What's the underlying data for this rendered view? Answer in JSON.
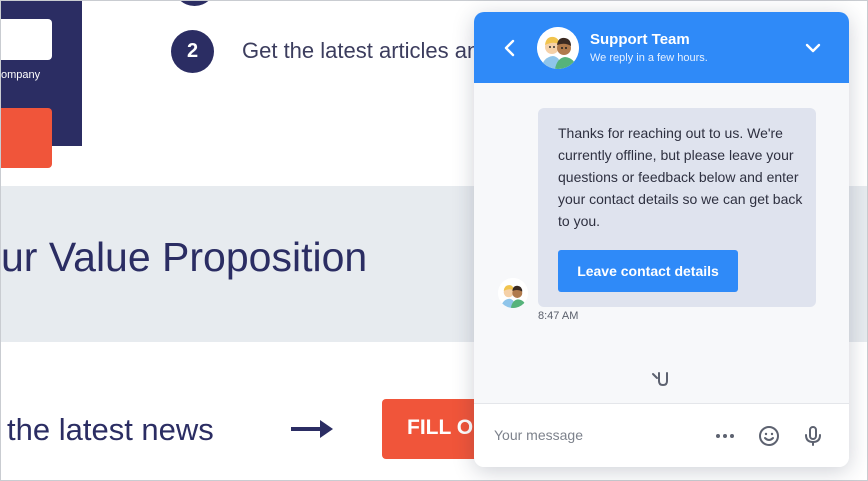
{
  "website": {
    "company_partial": "ompany",
    "step_number": "2",
    "step_text": "Get the latest articles and",
    "value_title": "ur Value Proposition",
    "news_text": "the latest news",
    "fill_button": "FILL OU"
  },
  "chat": {
    "header": {
      "title": "Support Team",
      "status": "We reply in a few hours.",
      "back_icon": "chevron-left-icon",
      "collapse_icon": "chevron-down-icon"
    },
    "message": {
      "text": "Thanks for reaching out to us. We're currently offline, but please leave your questions or feedback below and enter your contact details so we can get back to you.",
      "button_label": "Leave contact details",
      "time": "8:47 AM"
    },
    "composer": {
      "placeholder": "Your message",
      "icons": [
        "more-icon",
        "emoji-icon",
        "mic-icon"
      ]
    }
  },
  "colors": {
    "accent": "#2f8af8",
    "navy": "#2b2d63",
    "orange": "#f0553a",
    "band": "#e7ebef",
    "bubble": "#dfe3ee"
  }
}
